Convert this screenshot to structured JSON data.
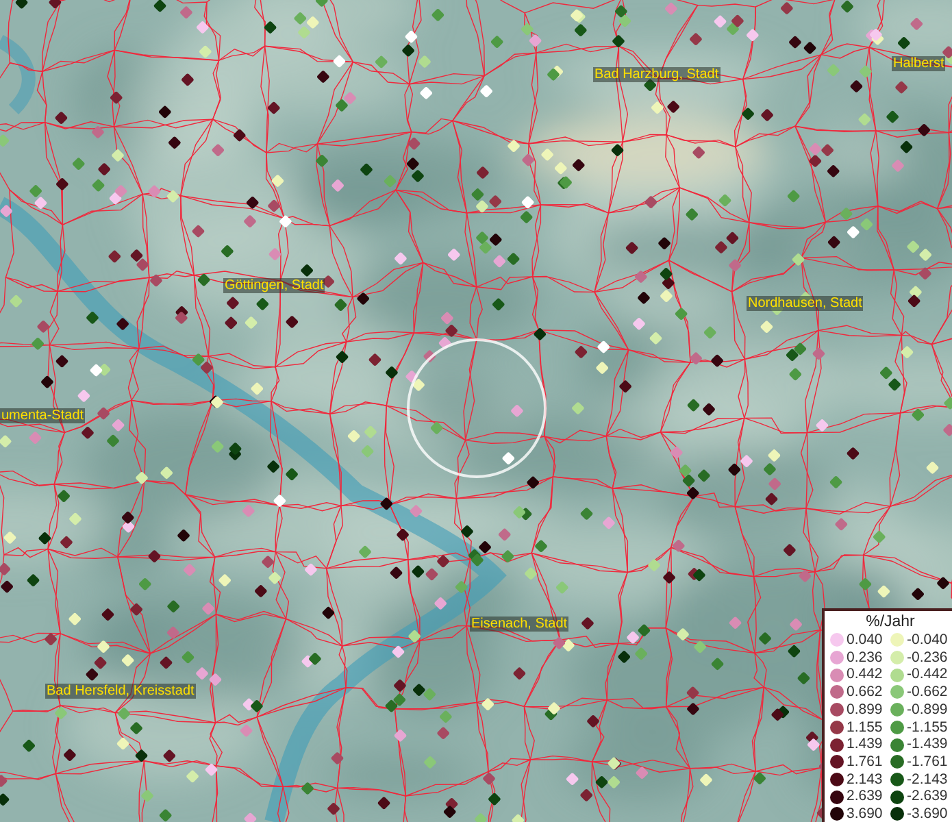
{
  "map": {
    "places": [
      {
        "name": "Bad Harzburg, Stadt"
      },
      {
        "name": "Halberst"
      },
      {
        "name": "Göttingen, Stadt"
      },
      {
        "name": "Nordhausen, Stadt"
      },
      {
        "name": "umenta-Stadt"
      },
      {
        "name": "Eisenach, Stadt"
      },
      {
        "name": "Bad Hersfeld, Kreisstadt"
      }
    ]
  },
  "legend": {
    "title": "%/Jahr",
    "rows": [
      {
        "positive": {
          "label": "0.040",
          "color": "#f6c8ee"
        },
        "negative": {
          "label": "-0.040",
          "color": "#eef5b8"
        }
      },
      {
        "positive": {
          "label": "0.236",
          "color": "#e7a6d3"
        },
        "negative": {
          "label": "-0.236",
          "color": "#d4edaa"
        }
      },
      {
        "positive": {
          "label": "0.442",
          "color": "#d98cb4"
        },
        "negative": {
          "label": "-0.442",
          "color": "#b0dc90"
        }
      },
      {
        "positive": {
          "label": "0.662",
          "color": "#c06a8a"
        },
        "negative": {
          "label": "-0.662",
          "color": "#8ac878"
        }
      },
      {
        "positive": {
          "label": "0.899",
          "color": "#a84a62"
        },
        "negative": {
          "label": "-0.899",
          "color": "#6ab05c"
        }
      },
      {
        "positive": {
          "label": "1.155",
          "color": "#953848"
        },
        "negative": {
          "label": "-1.155",
          "color": "#4e9a44"
        }
      },
      {
        "positive": {
          "label": "1.439",
          "color": "#7c2232"
        },
        "negative": {
          "label": "-1.439",
          "color": "#3a8434"
        }
      },
      {
        "positive": {
          "label": "1.761",
          "color": "#641424"
        },
        "negative": {
          "label": "-1.761",
          "color": "#286c24"
        }
      },
      {
        "positive": {
          "label": "2.143",
          "color": "#4c0a16"
        },
        "negative": {
          "label": "-2.143",
          "color": "#185818"
        }
      },
      {
        "positive": {
          "label": "2.639",
          "color": "#360610"
        },
        "negative": {
          "label": "-2.639",
          "color": "#0e4410"
        }
      },
      {
        "positive": {
          "label": "3.690",
          "color": "#220408"
        },
        "negative": {
          "label": "-3.690",
          "color": "#08300a"
        }
      }
    ]
  }
}
